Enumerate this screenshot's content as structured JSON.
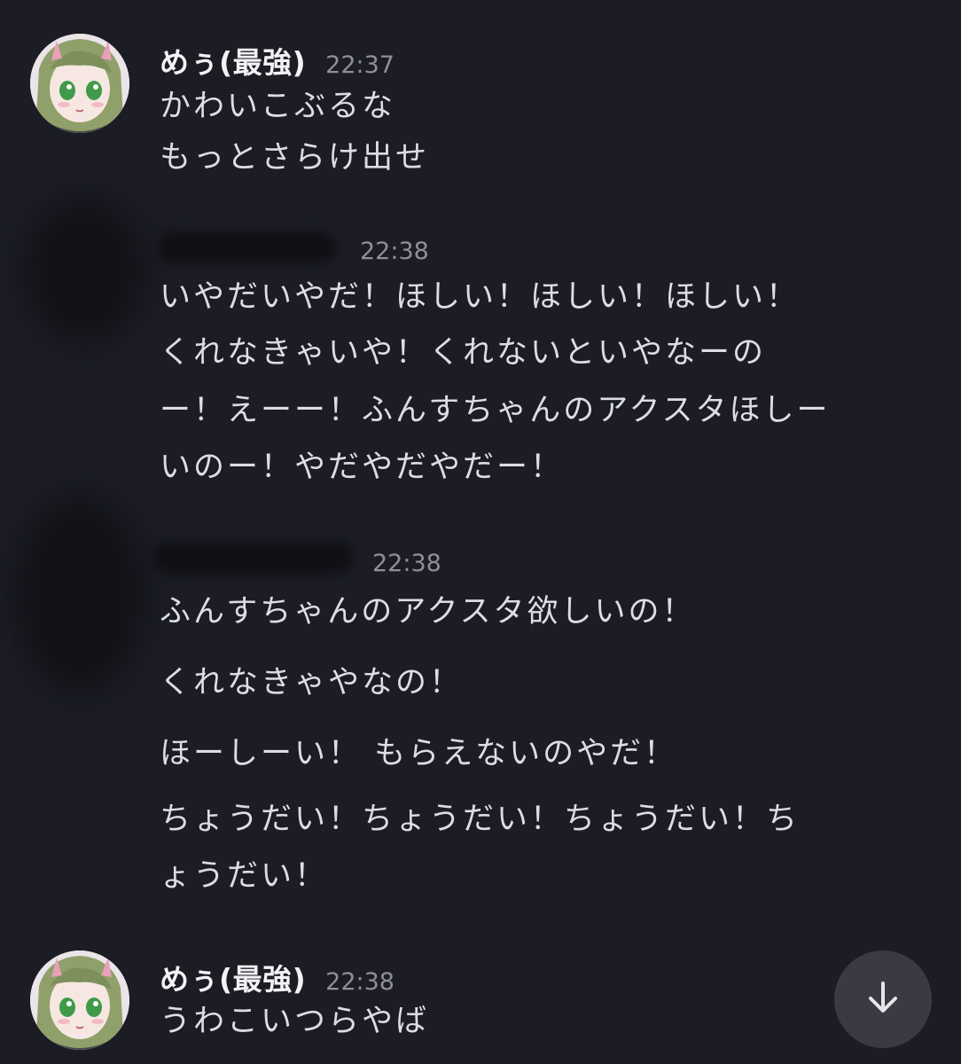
{
  "messages": [
    {
      "username": "めぅ(最強)",
      "time": "22:37",
      "lines": [
        "かわいこぶるな",
        "もっとさらけ出せ"
      ]
    },
    {
      "username": "",
      "time": "22:38",
      "lines": [
        "いやだいやだ！ほしい！ほしい！ほしい！",
        "くれなきゃいや！くれないといやなーの",
        "ー！えーー！ふんすちゃんのアクスタほしー",
        "いのー！やだやだやだー！"
      ]
    },
    {
      "username": "",
      "time": "22:38",
      "lines": [
        "ふんすちゃんのアクスタ欲しいの！",
        "くれなきゃやなの！",
        "ほーしーい！ もらえないのやだ！",
        "ちょうだい！ちょうだい！ちょうだい！ち",
        "ょうだい！"
      ]
    },
    {
      "username": "めぅ(最強)",
      "time": "22:38",
      "lines": [
        "うわこいつらやば"
      ]
    }
  ],
  "icons": {
    "avatar": "user-avatar",
    "scroll": "arrow-down-icon"
  },
  "colors": {
    "background": "#1b1c24",
    "text": "#dcdde2",
    "username": "#f2f2f5",
    "timestamp": "#8e8f99",
    "scroll_button": "#3a3b42"
  }
}
